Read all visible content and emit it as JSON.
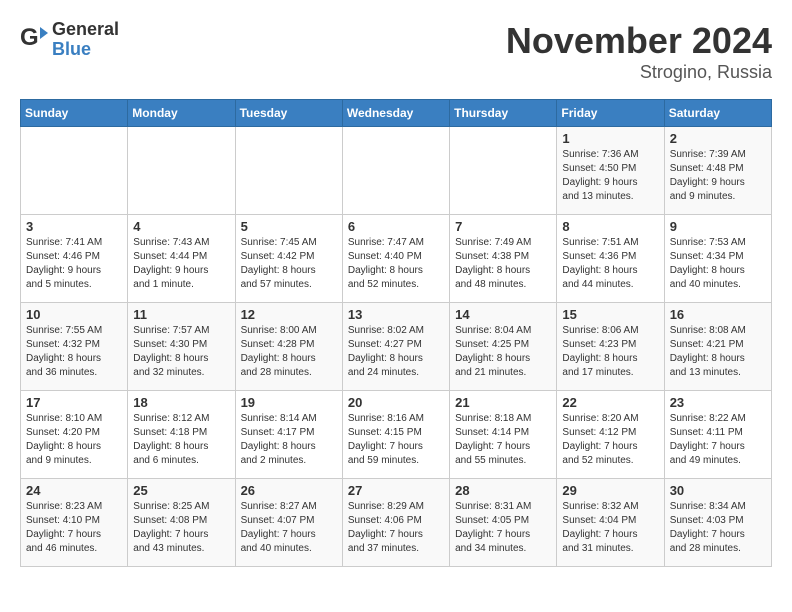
{
  "header": {
    "logo_general": "General",
    "logo_blue": "Blue",
    "month_title": "November 2024",
    "location": "Strogino, Russia"
  },
  "calendar": {
    "weekdays": [
      "Sunday",
      "Monday",
      "Tuesday",
      "Wednesday",
      "Thursday",
      "Friday",
      "Saturday"
    ],
    "weeks": [
      [
        {
          "day": "",
          "detail": ""
        },
        {
          "day": "",
          "detail": ""
        },
        {
          "day": "",
          "detail": ""
        },
        {
          "day": "",
          "detail": ""
        },
        {
          "day": "",
          "detail": ""
        },
        {
          "day": "1",
          "detail": "Sunrise: 7:36 AM\nSunset: 4:50 PM\nDaylight: 9 hours\nand 13 minutes."
        },
        {
          "day": "2",
          "detail": "Sunrise: 7:39 AM\nSunset: 4:48 PM\nDaylight: 9 hours\nand 9 minutes."
        }
      ],
      [
        {
          "day": "3",
          "detail": "Sunrise: 7:41 AM\nSunset: 4:46 PM\nDaylight: 9 hours\nand 5 minutes."
        },
        {
          "day": "4",
          "detail": "Sunrise: 7:43 AM\nSunset: 4:44 PM\nDaylight: 9 hours\nand 1 minute."
        },
        {
          "day": "5",
          "detail": "Sunrise: 7:45 AM\nSunset: 4:42 PM\nDaylight: 8 hours\nand 57 minutes."
        },
        {
          "day": "6",
          "detail": "Sunrise: 7:47 AM\nSunset: 4:40 PM\nDaylight: 8 hours\nand 52 minutes."
        },
        {
          "day": "7",
          "detail": "Sunrise: 7:49 AM\nSunset: 4:38 PM\nDaylight: 8 hours\nand 48 minutes."
        },
        {
          "day": "8",
          "detail": "Sunrise: 7:51 AM\nSunset: 4:36 PM\nDaylight: 8 hours\nand 44 minutes."
        },
        {
          "day": "9",
          "detail": "Sunrise: 7:53 AM\nSunset: 4:34 PM\nDaylight: 8 hours\nand 40 minutes."
        }
      ],
      [
        {
          "day": "10",
          "detail": "Sunrise: 7:55 AM\nSunset: 4:32 PM\nDaylight: 8 hours\nand 36 minutes."
        },
        {
          "day": "11",
          "detail": "Sunrise: 7:57 AM\nSunset: 4:30 PM\nDaylight: 8 hours\nand 32 minutes."
        },
        {
          "day": "12",
          "detail": "Sunrise: 8:00 AM\nSunset: 4:28 PM\nDaylight: 8 hours\nand 28 minutes."
        },
        {
          "day": "13",
          "detail": "Sunrise: 8:02 AM\nSunset: 4:27 PM\nDaylight: 8 hours\nand 24 minutes."
        },
        {
          "day": "14",
          "detail": "Sunrise: 8:04 AM\nSunset: 4:25 PM\nDaylight: 8 hours\nand 21 minutes."
        },
        {
          "day": "15",
          "detail": "Sunrise: 8:06 AM\nSunset: 4:23 PM\nDaylight: 8 hours\nand 17 minutes."
        },
        {
          "day": "16",
          "detail": "Sunrise: 8:08 AM\nSunset: 4:21 PM\nDaylight: 8 hours\nand 13 minutes."
        }
      ],
      [
        {
          "day": "17",
          "detail": "Sunrise: 8:10 AM\nSunset: 4:20 PM\nDaylight: 8 hours\nand 9 minutes."
        },
        {
          "day": "18",
          "detail": "Sunrise: 8:12 AM\nSunset: 4:18 PM\nDaylight: 8 hours\nand 6 minutes."
        },
        {
          "day": "19",
          "detail": "Sunrise: 8:14 AM\nSunset: 4:17 PM\nDaylight: 8 hours\nand 2 minutes."
        },
        {
          "day": "20",
          "detail": "Sunrise: 8:16 AM\nSunset: 4:15 PM\nDaylight: 7 hours\nand 59 minutes."
        },
        {
          "day": "21",
          "detail": "Sunrise: 8:18 AM\nSunset: 4:14 PM\nDaylight: 7 hours\nand 55 minutes."
        },
        {
          "day": "22",
          "detail": "Sunrise: 8:20 AM\nSunset: 4:12 PM\nDaylight: 7 hours\nand 52 minutes."
        },
        {
          "day": "23",
          "detail": "Sunrise: 8:22 AM\nSunset: 4:11 PM\nDaylight: 7 hours\nand 49 minutes."
        }
      ],
      [
        {
          "day": "24",
          "detail": "Sunrise: 8:23 AM\nSunset: 4:10 PM\nDaylight: 7 hours\nand 46 minutes."
        },
        {
          "day": "25",
          "detail": "Sunrise: 8:25 AM\nSunset: 4:08 PM\nDaylight: 7 hours\nand 43 minutes."
        },
        {
          "day": "26",
          "detail": "Sunrise: 8:27 AM\nSunset: 4:07 PM\nDaylight: 7 hours\nand 40 minutes."
        },
        {
          "day": "27",
          "detail": "Sunrise: 8:29 AM\nSunset: 4:06 PM\nDaylight: 7 hours\nand 37 minutes."
        },
        {
          "day": "28",
          "detail": "Sunrise: 8:31 AM\nSunset: 4:05 PM\nDaylight: 7 hours\nand 34 minutes."
        },
        {
          "day": "29",
          "detail": "Sunrise: 8:32 AM\nSunset: 4:04 PM\nDaylight: 7 hours\nand 31 minutes."
        },
        {
          "day": "30",
          "detail": "Sunrise: 8:34 AM\nSunset: 4:03 PM\nDaylight: 7 hours\nand 28 minutes."
        }
      ]
    ]
  }
}
